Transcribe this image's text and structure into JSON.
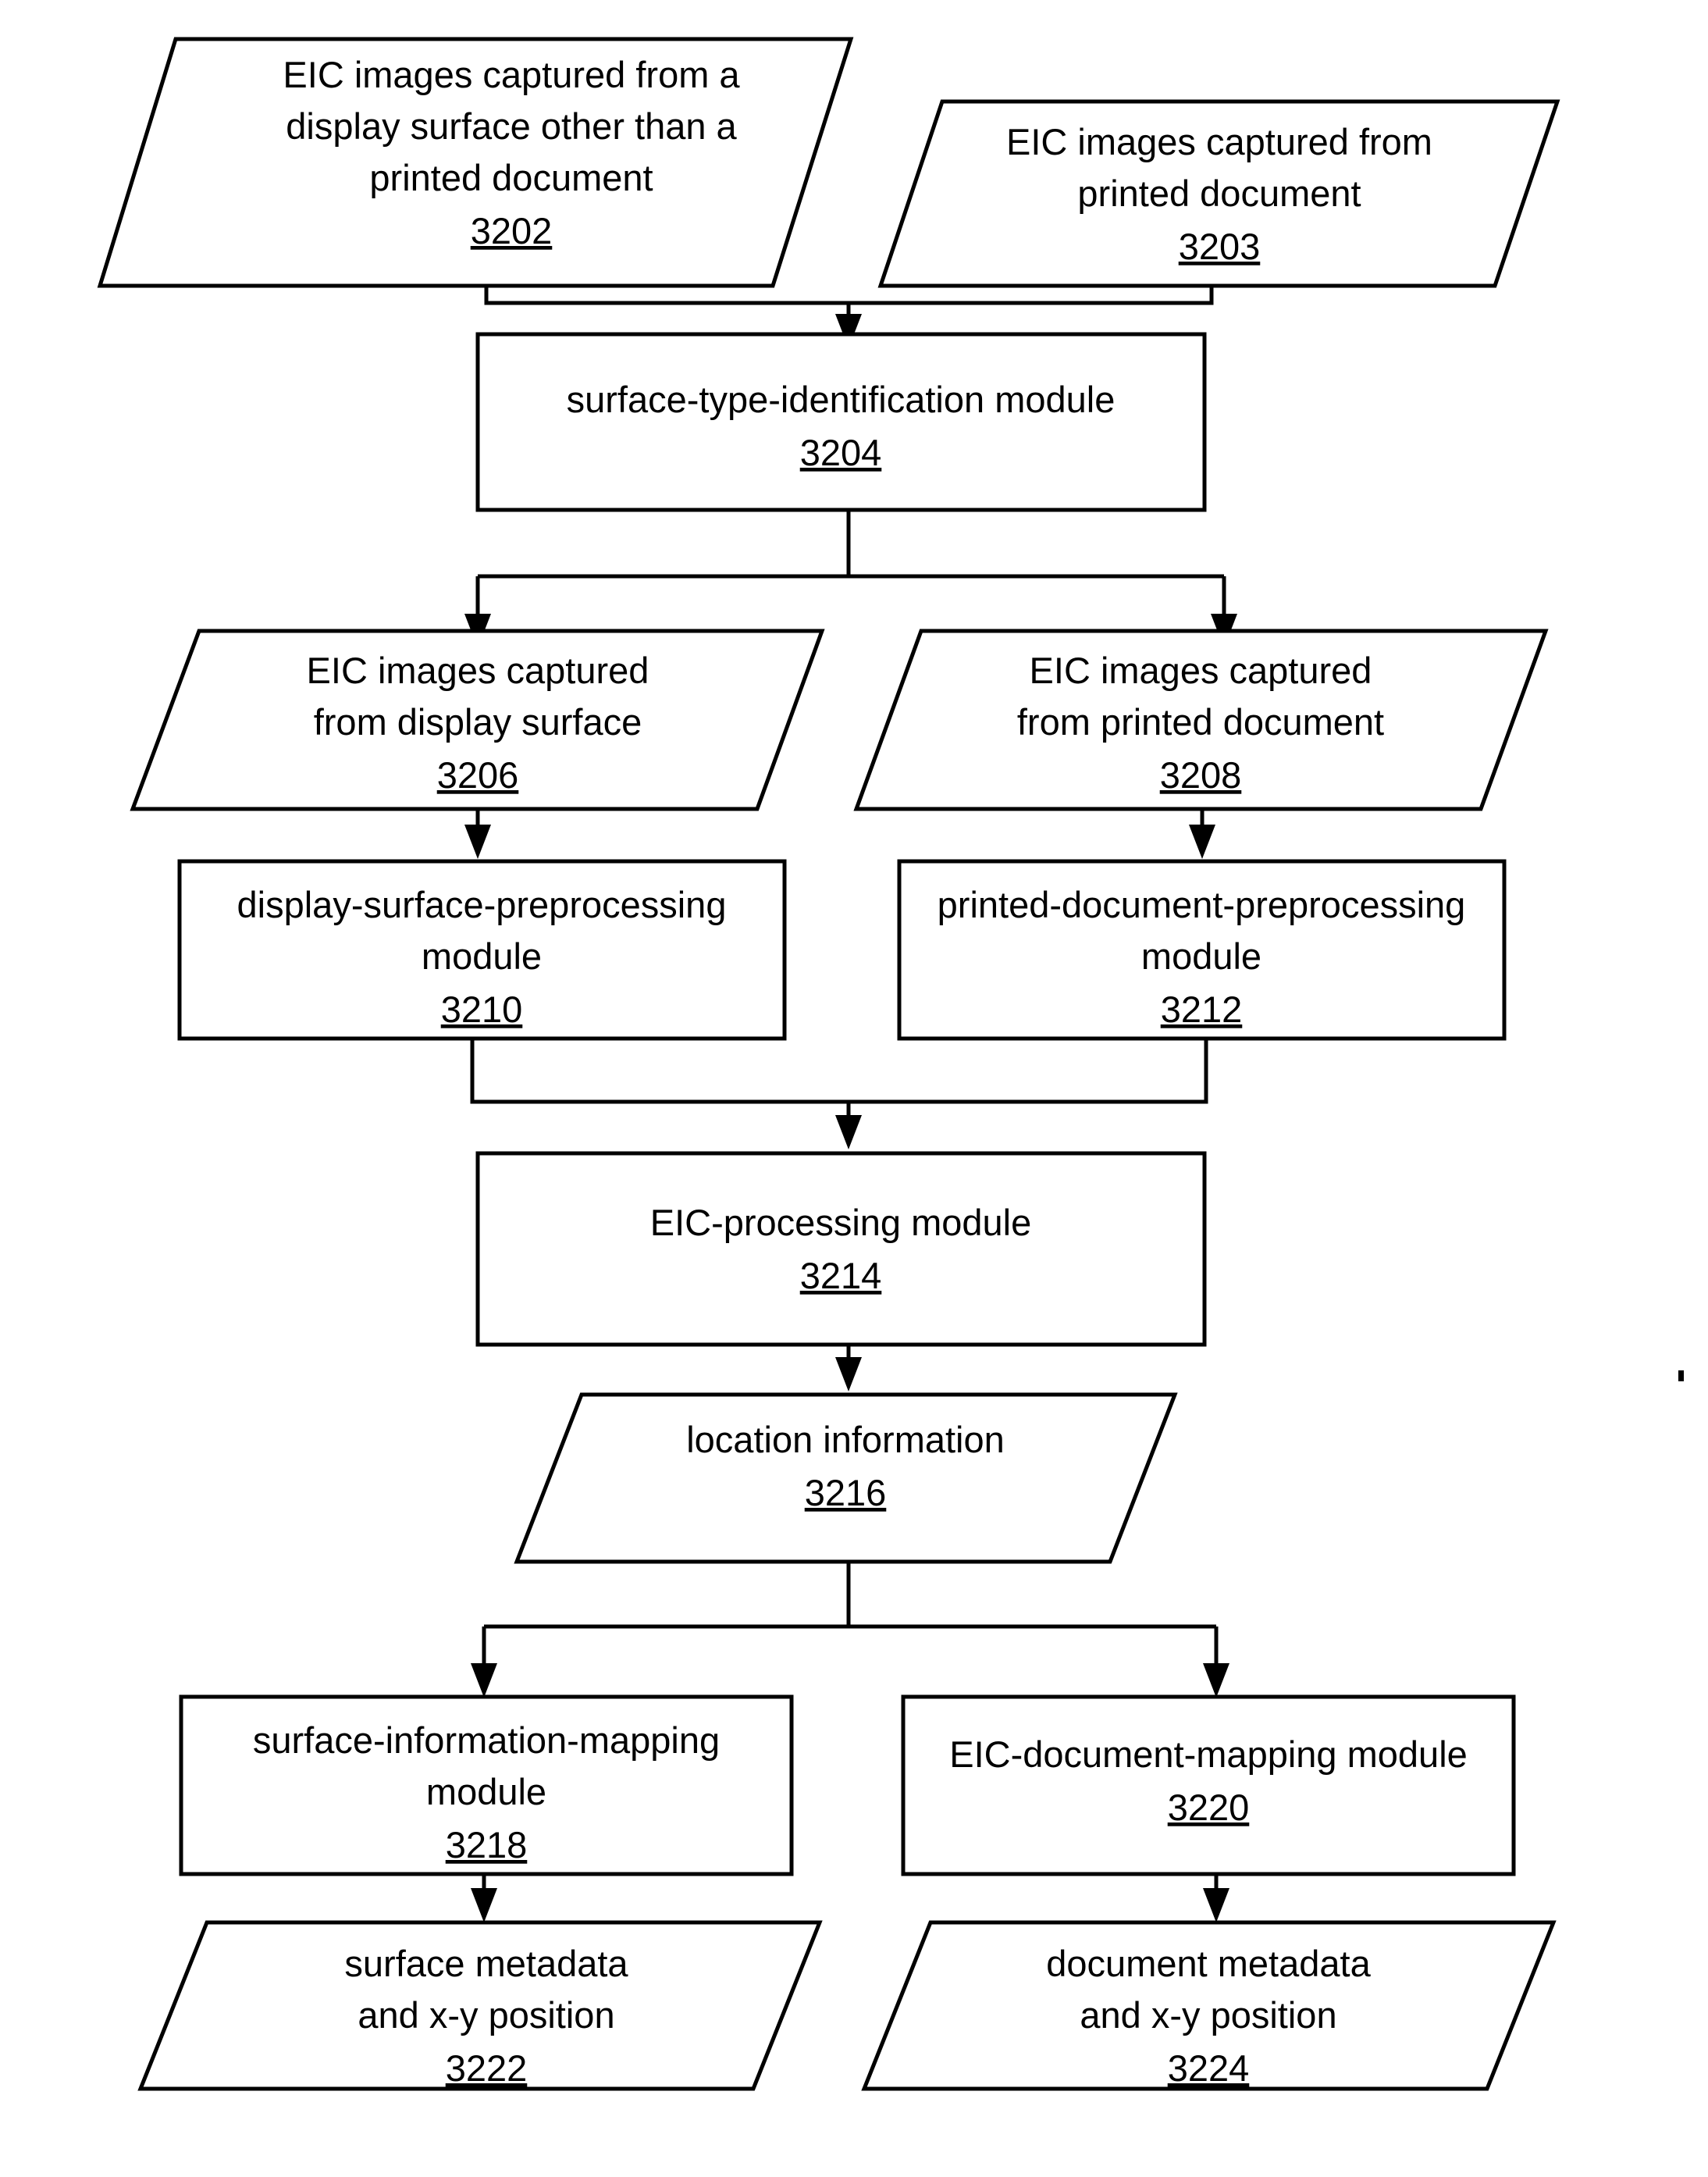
{
  "diagram": {
    "type": "flowchart",
    "title": "EIC image processing flowchart",
    "orientation": "top-to-bottom",
    "colors": {
      "background": "#ffffff",
      "stroke": "#000000",
      "text": "#000000"
    },
    "nodes": [
      {
        "id": "n3202",
        "shape": "parallelogram",
        "ref": "3202",
        "lines": [
          "EIC images captured from a",
          "display surface other than a",
          "printed document"
        ]
      },
      {
        "id": "n3203",
        "shape": "parallelogram",
        "ref": "3203",
        "lines": [
          "EIC images captured from",
          "printed document"
        ]
      },
      {
        "id": "n3204",
        "shape": "rectangle",
        "ref": "3204",
        "lines": [
          "surface-type-identification module"
        ]
      },
      {
        "id": "n3206",
        "shape": "parallelogram",
        "ref": "3206",
        "lines": [
          "EIC images captured",
          "from display surface"
        ]
      },
      {
        "id": "n3208",
        "shape": "parallelogram",
        "ref": "3208",
        "lines": [
          "EIC images captured",
          "from printed document"
        ]
      },
      {
        "id": "n3210",
        "shape": "rectangle",
        "ref": "3210",
        "lines": [
          "display-surface-preprocessing",
          "module"
        ]
      },
      {
        "id": "n3212",
        "shape": "rectangle",
        "ref": "3212",
        "lines": [
          "printed-document-preprocessing",
          "module"
        ]
      },
      {
        "id": "n3214",
        "shape": "rectangle",
        "ref": "3214",
        "lines": [
          "EIC-processing module"
        ]
      },
      {
        "id": "n3216",
        "shape": "parallelogram",
        "ref": "3216",
        "lines": [
          "location information"
        ]
      },
      {
        "id": "n3218",
        "shape": "rectangle",
        "ref": "3218",
        "lines": [
          "surface-information-mapping",
          "module"
        ]
      },
      {
        "id": "n3220",
        "shape": "rectangle",
        "ref": "3220",
        "lines": [
          "EIC-document-mapping module"
        ]
      },
      {
        "id": "n3222",
        "shape": "parallelogram",
        "ref": "3222",
        "lines": [
          "surface metadata",
          "and x-y position"
        ]
      },
      {
        "id": "n3224",
        "shape": "parallelogram",
        "ref": "3224",
        "lines": [
          "document metadata",
          "and x-y position"
        ]
      }
    ],
    "edges": [
      {
        "from": "n3202",
        "to": "n3204",
        "style": "merge"
      },
      {
        "from": "n3203",
        "to": "n3204",
        "style": "merge"
      },
      {
        "from": "n3204",
        "to": "n3206",
        "style": "split"
      },
      {
        "from": "n3204",
        "to": "n3208",
        "style": "split"
      },
      {
        "from": "n3206",
        "to": "n3210",
        "style": "direct"
      },
      {
        "from": "n3208",
        "to": "n3212",
        "style": "direct"
      },
      {
        "from": "n3210",
        "to": "n3214",
        "style": "merge"
      },
      {
        "from": "n3212",
        "to": "n3214",
        "style": "merge"
      },
      {
        "from": "n3214",
        "to": "n3216",
        "style": "direct"
      },
      {
        "from": "n3216",
        "to": "n3218",
        "style": "split"
      },
      {
        "from": "n3216",
        "to": "n3220",
        "style": "split"
      },
      {
        "from": "n3218",
        "to": "n3222",
        "style": "direct"
      },
      {
        "from": "n3220",
        "to": "n3224",
        "style": "direct"
      }
    ]
  }
}
